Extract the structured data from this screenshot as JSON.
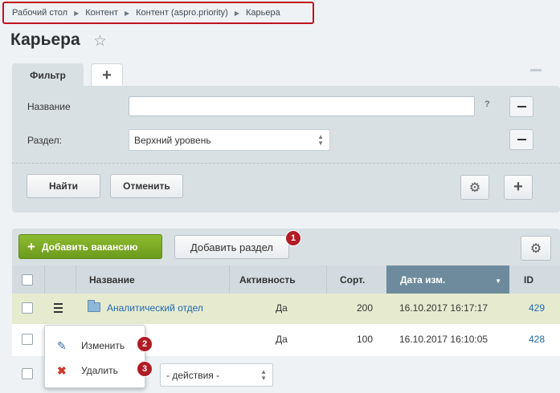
{
  "breadcrumb": [
    "Рабочий стол",
    "Контент",
    "Контент (aspro.priority)",
    "Карьера"
  ],
  "page_title": "Карьера",
  "filter": {
    "tab_label": "Фильтр",
    "add_tab": "+",
    "fields": [
      {
        "label": "Название",
        "value": "",
        "help": "?"
      },
      {
        "label": "Раздел:",
        "value": "Верхний уровень"
      }
    ],
    "find_label": "Найти",
    "cancel_label": "Отменить"
  },
  "toolbar": {
    "add_vacancy": "Добавить вакансию",
    "add_section": "Добавить раздел"
  },
  "table": {
    "columns": [
      "Название",
      "Активность",
      "Сорт.",
      "Дата изм.",
      "ID"
    ],
    "rows": [
      {
        "name": "Аналитический отдел",
        "active": "Да",
        "sort": "200",
        "date": "16.10.2017 16:17:17",
        "id": "429"
      },
      {
        "name": "",
        "active": "Да",
        "sort": "100",
        "date": "16.10.2017 16:10:05",
        "id": "428"
      }
    ]
  },
  "context_menu": [
    {
      "label": "Изменить",
      "icon": "pencil-edit-icon"
    },
    {
      "label": "Удалить",
      "icon": "delete-x-icon"
    }
  ],
  "actions_select": "- действия -",
  "badges": [
    "1",
    "2",
    "3"
  ],
  "colors": {
    "add_button": "#78a622",
    "badge": "#b01c25",
    "sorted_header": "#6d8b9c",
    "highlight_frame": "#c1121f",
    "link": "#2067b0"
  }
}
